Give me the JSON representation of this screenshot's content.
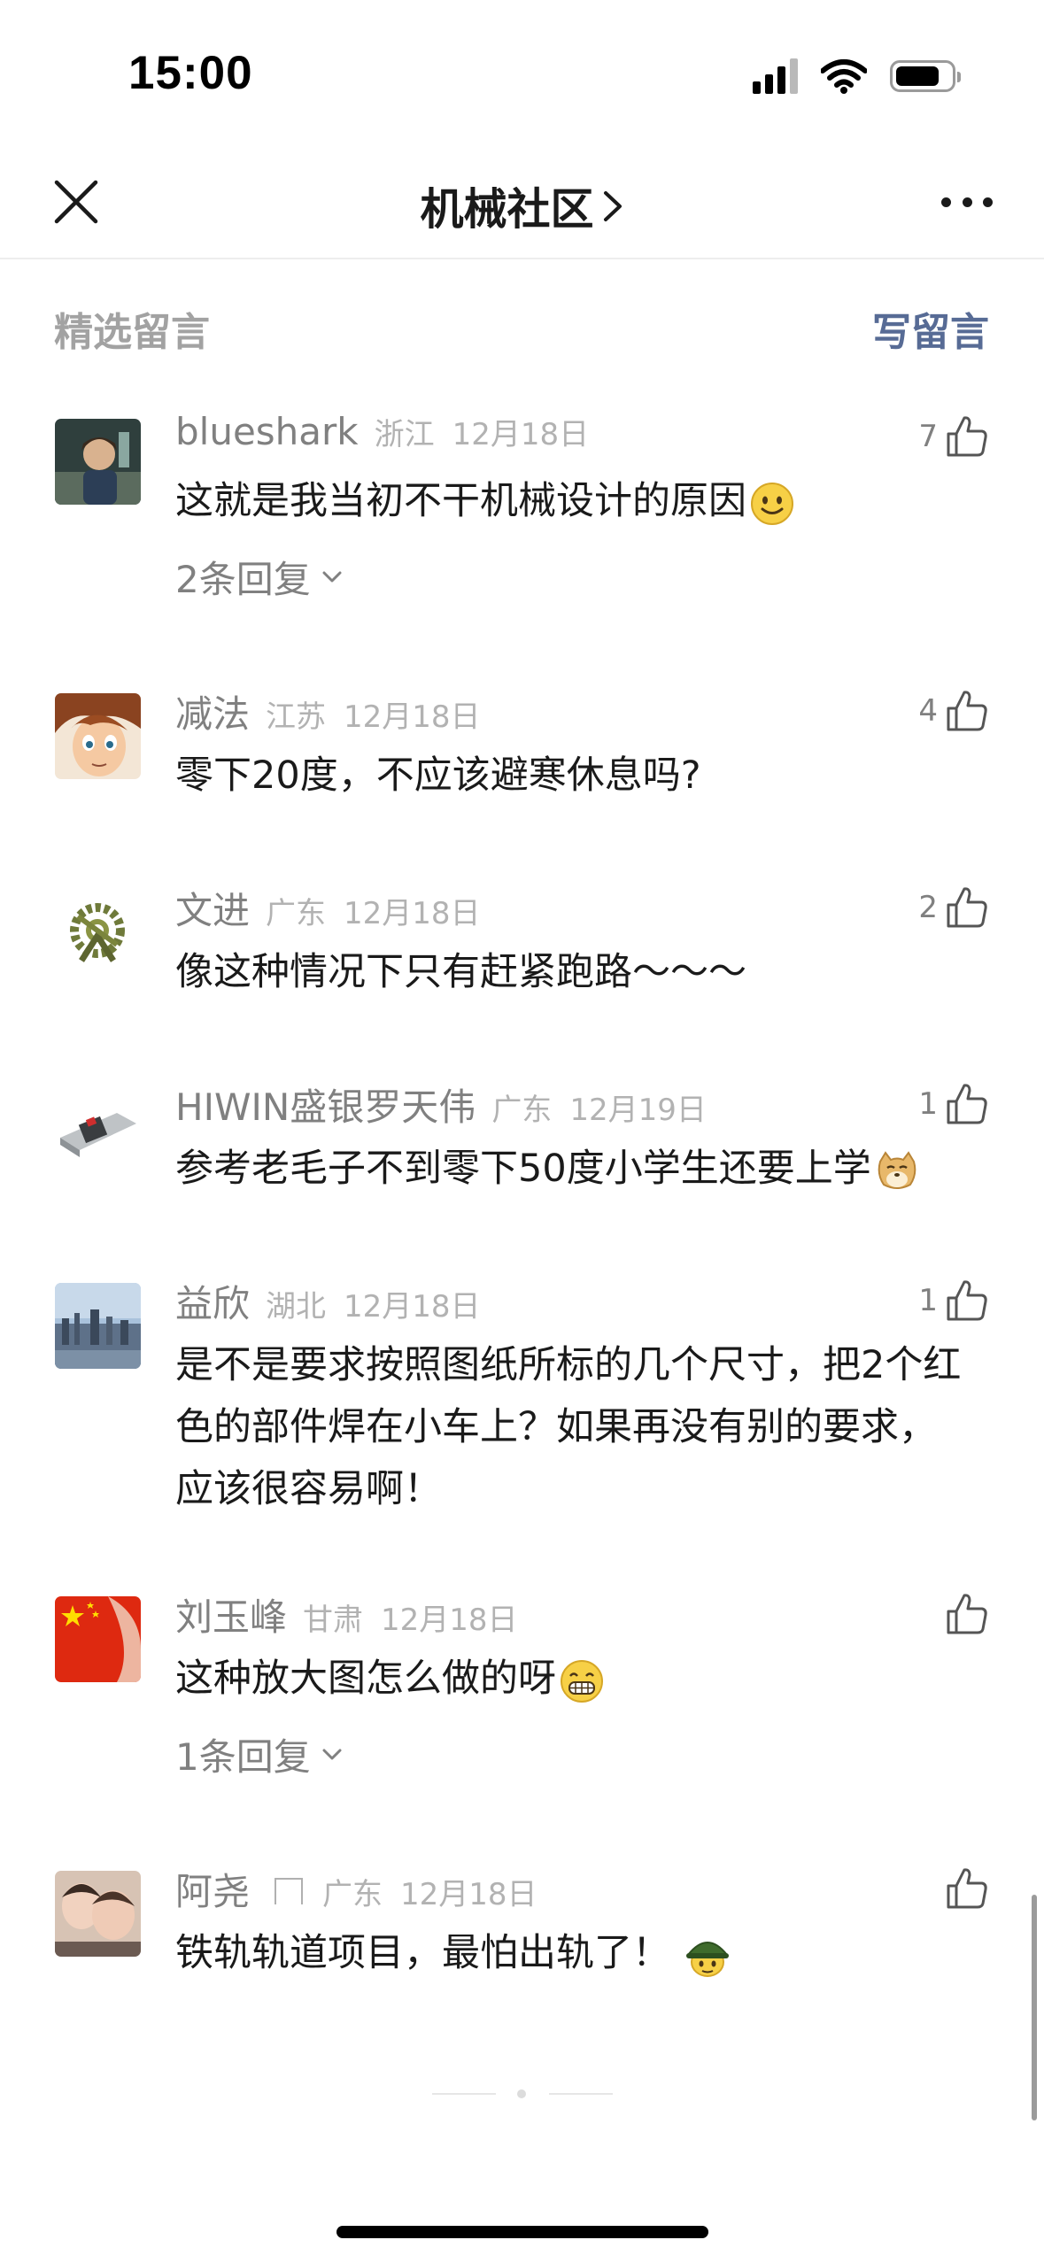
{
  "status_bar": {
    "time": "15:00",
    "signal_icon": "cellular-signal-icon",
    "wifi_icon": "wifi-icon",
    "battery_icon": "battery-icon"
  },
  "nav": {
    "close_icon": "close-icon",
    "title": "机械社区",
    "chevron_icon": "chevron-right-icon",
    "more_icon": "more-icon"
  },
  "section": {
    "title": "精选留言",
    "write_label": "写留言",
    "accent_color": "#576b95"
  },
  "comments": [
    {
      "nickname": "blueshark",
      "region": "浙江",
      "date": "12月18日",
      "likes": "7",
      "content": "这就是我当初不干机械设计的原因",
      "emoji": "smile-emoji",
      "replies": "2条回复"
    },
    {
      "nickname": "减法",
      "region": "江苏",
      "date": "12月18日",
      "likes": "4",
      "content": "零下20度，不应该避寒休息吗?"
    },
    {
      "nickname": "文进",
      "region": "广东",
      "date": "12月18日",
      "likes": "2",
      "content": "像这种情况下只有赶紧跑路～～～"
    },
    {
      "nickname": "HIWIN盛银罗天伟",
      "region": "广东",
      "date": "12月19日",
      "likes": "1",
      "content": "参考老毛子不到零下50度小学生还要上学",
      "emoji": "doge-emoji"
    },
    {
      "nickname": "益欣",
      "region": "湖北",
      "date": "12月18日",
      "likes": "1",
      "content": "是不是要求按照图纸所标的几个尺寸，把2个红色的部件焊在小车上？如果再没有别的要求，应该很容易啊！"
    },
    {
      "nickname": "刘玉峰",
      "region": "甘肃",
      "date": "12月18日",
      "likes": "",
      "content": "这种放大图怎么做的呀",
      "emoji": "grin-emoji",
      "replies": "1条回复"
    },
    {
      "nickname": "阿尧",
      "region": "广东",
      "date": "12月18日",
      "likes": "",
      "content": "铁轨轨道项目，最怕出轨了！",
      "emoji": "soldier-emoji"
    }
  ]
}
